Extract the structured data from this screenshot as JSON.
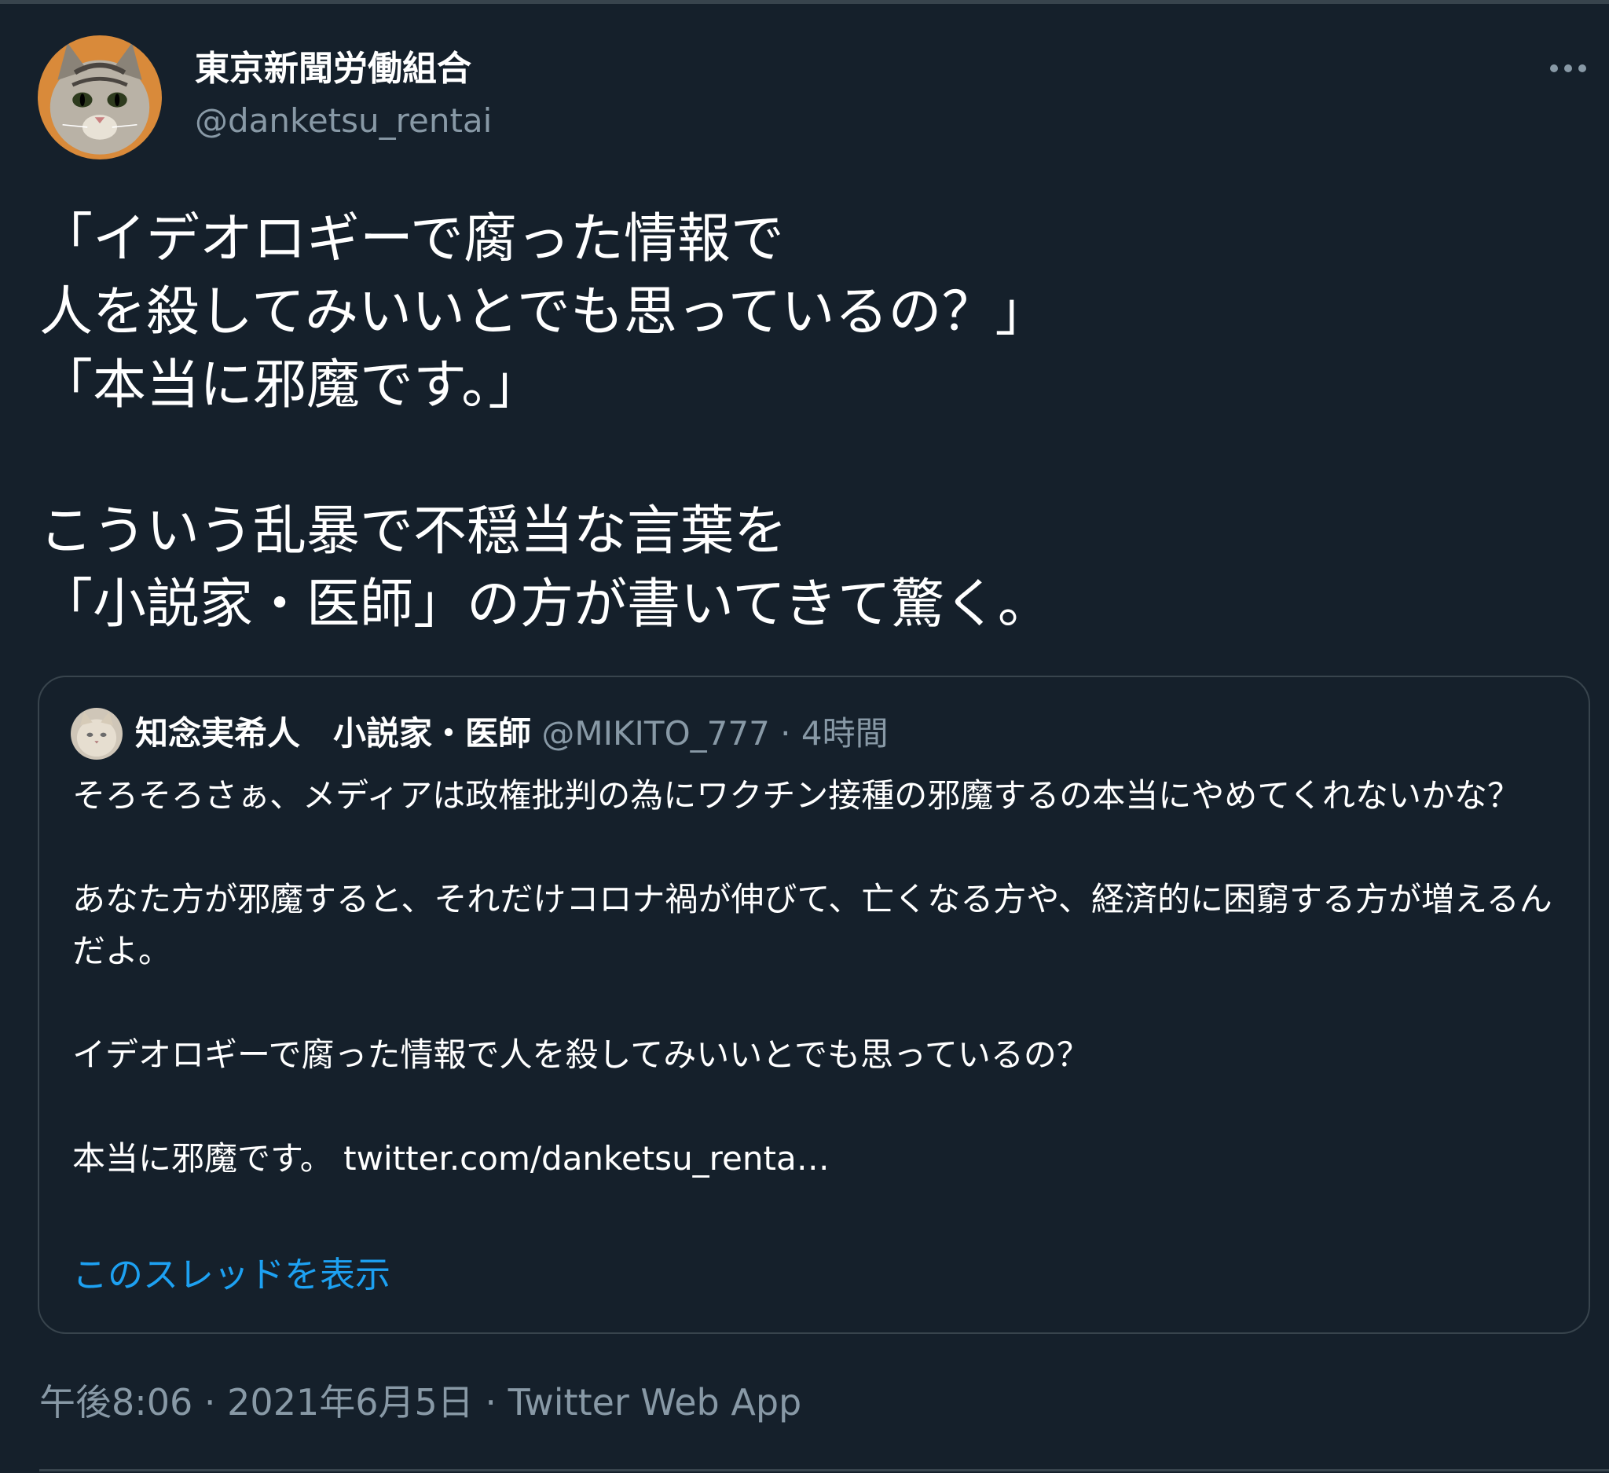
{
  "author": {
    "display_name": "東京新聞労働組合",
    "handle": "@danketsu_rentai"
  },
  "tweet": {
    "text": "「イデオロギーで腐った情報で\n人を殺してみいいとでも思っているの？」\n「本当に邪魔です。」\n\nこういう乱暴で不穏当な言葉を\n「小説家・医師」の方が書いてきて驚く。",
    "time": "午後8:06 · 2021年6月5日 · ",
    "source": "Twitter Web App"
  },
  "quoted_tweet": {
    "display_name": "知念実希人　小説家・医師",
    "handle": "@MIKITO_777",
    "separator": " · ",
    "relative_time": "4時間",
    "text": "そろそろさぁ、メディアは政権批判の為にワクチン接種の邪魔するの本当にやめてくれないかな？\n\nあなた方が邪魔すると、それだけコロナ禍が伸びて、亡くなる方や、経済的に困窮する方が増えるんだよ。\n\nイデオロギーで腐った情報で人を殺してみいいとでも思っているの？\n\n本当に邪魔です。 ",
    "link": "twitter.com/danketsu_renta…",
    "show_thread": "このスレッドを表示"
  },
  "icons": {
    "more": "more-horizontal-icon",
    "author_avatar": "cat-avatar",
    "quoted_avatar": "cat-avatar"
  },
  "colors": {
    "background": "#15202b",
    "border": "#38444d",
    "secondary_text": "#8899a6",
    "link_accent": "#1da1f2"
  }
}
